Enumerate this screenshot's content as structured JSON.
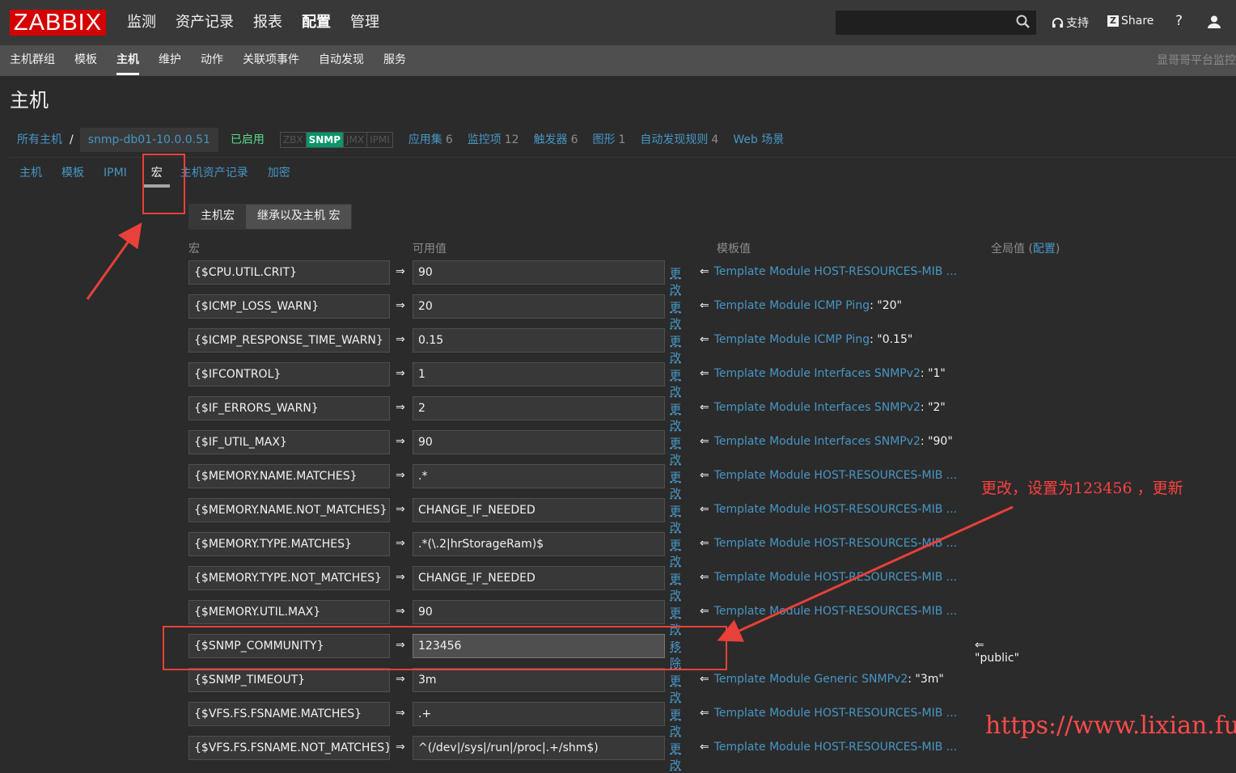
{
  "app": {
    "logo": "ZABBIX",
    "main_menu": [
      "监测",
      "资产记录",
      "报表",
      "配置",
      "管理"
    ],
    "active_main": "配置",
    "search_value": "",
    "support_label": "支持",
    "share_label": "Share",
    "help_label": "?"
  },
  "sub_menu": {
    "items": [
      "主机群组",
      "模板",
      "主机",
      "维护",
      "动作",
      "关联项事件",
      "自动发现",
      "服务"
    ],
    "active": "主机",
    "brand": "显哥哥平台监控"
  },
  "page": {
    "title": "主机"
  },
  "breadcrumb": {
    "all_hosts": "所有主机",
    "sep": "/",
    "host": "snmp-db01-10.0.0.51",
    "status": "已启用",
    "availability": [
      "ZBX",
      "SNMP",
      "JMX",
      "IPMI"
    ],
    "links": [
      {
        "label": "应用集",
        "count": "6"
      },
      {
        "label": "监控项",
        "count": "12"
      },
      {
        "label": "触发器",
        "count": "6"
      },
      {
        "label": "图形",
        "count": "1"
      },
      {
        "label": "自动发现规则",
        "count": "4"
      },
      {
        "label": "Web 场景",
        "count": ""
      }
    ]
  },
  "tabs": [
    "主机",
    "模板",
    "IPMI",
    "宏",
    "主机资产记录",
    "加密"
  ],
  "active_tab": "宏",
  "macro_toggle": [
    "主机宏",
    "继承以及主机 宏"
  ],
  "columns": {
    "macro": "宏",
    "effective_value": "可用值",
    "template_value": "模板值",
    "global_value": "全局值 (",
    "global_link": "配置",
    "global_close": ")"
  },
  "arrow": "⇒",
  "left_arrow": "⇐",
  "macros": [
    {
      "macro": "{$CPU.UTIL.CRIT}",
      "value": "90",
      "action": "更改",
      "template": "Template Module HOST-RESOURCES-MIB ...",
      "tvalue": ""
    },
    {
      "macro": "{$ICMP_LOSS_WARN}",
      "value": "20",
      "action": "更改",
      "template": "Template Module ICMP Ping",
      "tvalue": ": \"20\""
    },
    {
      "macro": "{$ICMP_RESPONSE_TIME_WARN}",
      "value": "0.15",
      "action": "更改",
      "template": "Template Module ICMP Ping",
      "tvalue": ": \"0.15\""
    },
    {
      "macro": "{$IFCONTROL}",
      "value": "1",
      "action": "更改",
      "template": "Template Module Interfaces SNMPv2",
      "tvalue": ": \"1\""
    },
    {
      "macro": "{$IF_ERRORS_WARN}",
      "value": "2",
      "action": "更改",
      "template": "Template Module Interfaces SNMPv2",
      "tvalue": ": \"2\""
    },
    {
      "macro": "{$IF_UTIL_MAX}",
      "value": "90",
      "action": "更改",
      "template": "Template Module Interfaces SNMPv2",
      "tvalue": ": \"90\""
    },
    {
      "macro": "{$MEMORY.NAME.MATCHES}",
      "value": ".*",
      "action": "更改",
      "template": "Template Module HOST-RESOURCES-MIB ...",
      "tvalue": ""
    },
    {
      "macro": "{$MEMORY.NAME.NOT_MATCHES}",
      "value": "CHANGE_IF_NEEDED",
      "action": "更改",
      "template": "Template Module HOST-RESOURCES-MIB ...",
      "tvalue": ""
    },
    {
      "macro": "{$MEMORY.TYPE.MATCHES}",
      "value": ".*(\\.2|hrStorageRam)$",
      "action": "更改",
      "template": "Template Module HOST-RESOURCES-MIB ...",
      "tvalue": ""
    },
    {
      "macro": "{$MEMORY.TYPE.NOT_MATCHES}",
      "value": "CHANGE_IF_NEEDED",
      "action": "更改",
      "template": "Template Module HOST-RESOURCES-MIB ...",
      "tvalue": ""
    },
    {
      "macro": "{$MEMORY.UTIL.MAX}",
      "value": "90",
      "action": "更改",
      "template": "Template Module HOST-RESOURCES-MIB ...",
      "tvalue": ""
    },
    {
      "macro": "{$SNMP_COMMUNITY}",
      "value": "123456",
      "action": "移除",
      "template": "",
      "tvalue": "",
      "global": "\"public\""
    },
    {
      "macro": "{$SNMP_TIMEOUT}",
      "value": "3m",
      "action": "更改",
      "template": "Template Module Generic SNMPv2",
      "tvalue": ": \"3m\""
    },
    {
      "macro": "{$VFS.FS.FSNAME.MATCHES}",
      "value": ".+",
      "action": "更改",
      "template": "Template Module HOST-RESOURCES-MIB ...",
      "tvalue": ""
    },
    {
      "macro": "{$VFS.FS.FSNAME.NOT_MATCHES}",
      "value": "^(/dev|/sys|/run|/proc|.+/shm$)",
      "action": "更改",
      "template": "Template Module HOST-RESOURCES-MIB ...",
      "tvalue": ""
    }
  ],
  "annotation": {
    "text": "更改，设置为123456 ，更新",
    "watermark": "https://www.lixian.fun"
  },
  "colors": {
    "accent_link": "#4796c4",
    "annotation_red": "#e8403a",
    "enabled_green": "#59db8f",
    "snmp_green": "#059669"
  }
}
